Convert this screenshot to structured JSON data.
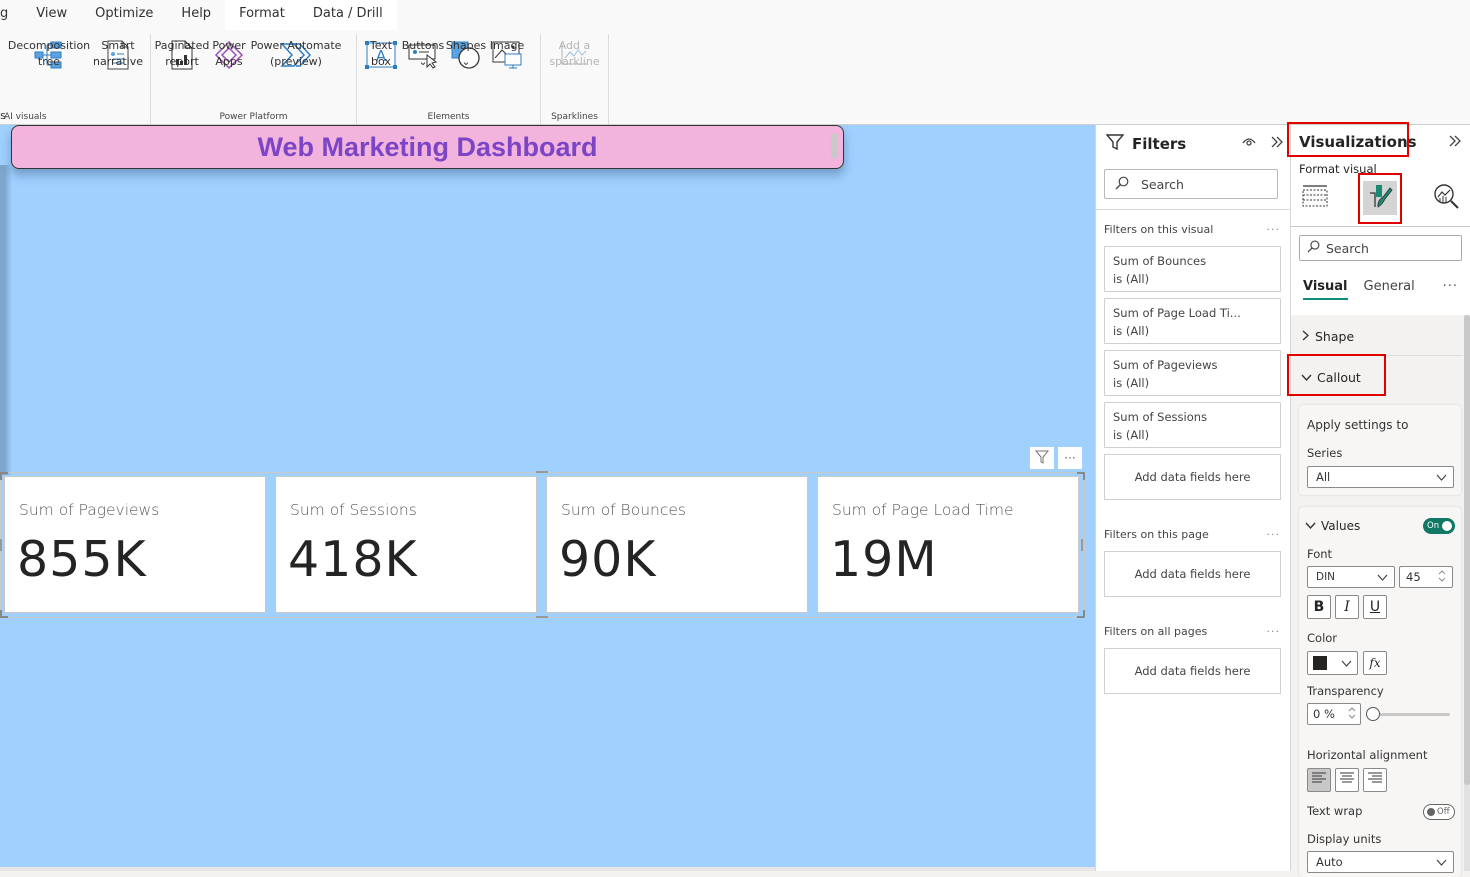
{
  "ribbon": {
    "tabs": [
      {
        "label": "g",
        "state": "normal"
      },
      {
        "label": "View",
        "state": "normal"
      },
      {
        "label": "Optimize",
        "state": "normal"
      },
      {
        "label": "Help",
        "state": "normal"
      },
      {
        "label": "Format",
        "state": "active"
      },
      {
        "label": "Data / Drill",
        "state": "contextual"
      }
    ],
    "groups": {
      "ai_visuals": {
        "label": "AI visuals",
        "partial_label": "s",
        "buttons": [
          {
            "label": "Decomposition\ntree",
            "icon": "decomposition-tree-icon"
          },
          {
            "label": "Smart\nnarrative",
            "icon": "smart-narrative-icon"
          }
        ]
      },
      "power_platform": {
        "label": "Power Platform",
        "buttons": [
          {
            "label": "Paginated\nreport",
            "icon": "paginated-report-icon"
          },
          {
            "label": "Power\nApps",
            "icon": "power-apps-icon"
          },
          {
            "label": "Power Automate\n(preview)",
            "icon": "power-automate-icon"
          }
        ]
      },
      "elements": {
        "label": "Elements",
        "buttons": [
          {
            "label": "Text\nbox",
            "icon": "text-box-icon"
          },
          {
            "label": "Buttons\n⌄",
            "icon": "buttons-icon"
          },
          {
            "label": "Shapes\n⌄",
            "icon": "shapes-icon"
          },
          {
            "label": "Image",
            "icon": "image-icon"
          }
        ]
      },
      "sparklines": {
        "label": "Sparklines",
        "buttons": [
          {
            "label": "Add a\nsparkline",
            "icon": "sparkline-icon",
            "disabled": true
          }
        ]
      }
    }
  },
  "canvas": {
    "background": "#a0d0fe",
    "title": {
      "text": "Web Marketing Dashboard",
      "bg": "#f2b3dc",
      "color": "#7b45c6"
    },
    "cards": [
      {
        "label": "Sum of Pageviews",
        "value": "855K"
      },
      {
        "label": "Sum of Sessions",
        "value": "418K"
      },
      {
        "label": "Sum of Bounces",
        "value": "90K"
      },
      {
        "label": "Sum of Page Load Time",
        "value": "19M"
      }
    ],
    "visual_header": {
      "filter_icon": "filter-icon",
      "more_label": "···"
    }
  },
  "filters": {
    "title": "Filters",
    "search_placeholder": "Search",
    "sections": {
      "visual": {
        "label": "Filters on this visual",
        "more": "···",
        "items": [
          {
            "field": "Sum of Bounces",
            "state": "is (All)"
          },
          {
            "field": "Sum of Page Load Ti...",
            "state": "is (All)"
          },
          {
            "field": "Sum of Pageviews",
            "state": "is (All)"
          },
          {
            "field": "Sum of Sessions",
            "state": "is (All)"
          }
        ],
        "add": "Add data fields here"
      },
      "page": {
        "label": "Filters on this page",
        "more": "···",
        "add": "Add data fields here"
      },
      "all": {
        "label": "Filters on all pages",
        "more": "···",
        "add": "Add data fields here"
      }
    }
  },
  "visualizations": {
    "title": "Visualizations",
    "subtitle": "Format visual",
    "search_placeholder": "Search",
    "tabs": [
      {
        "label": "Visual",
        "active": true
      },
      {
        "label": "General",
        "active": false
      }
    ],
    "more": "···",
    "sections": {
      "shape": {
        "label": "Shape",
        "expanded": false
      },
      "callout": {
        "label": "Callout",
        "expanded": true
      }
    },
    "apply_settings": {
      "label": "Apply settings to",
      "series_label": "Series",
      "series_value": "All"
    },
    "values": {
      "label": "Values",
      "toggle": "On",
      "font_label": "Font",
      "font_family": "DIN",
      "font_size": "45",
      "bold": "B",
      "italic": "I",
      "underline": "U",
      "color_label": "Color",
      "color_value": "#252423",
      "fx": "fx",
      "transparency_label": "Transparency",
      "transparency_value": "0 %",
      "transparency_percent": 0,
      "halign_label": "Horizontal alignment",
      "halign_selected": "left",
      "textwrap_label": "Text wrap",
      "textwrap_toggle": "Off",
      "display_units_label": "Display units",
      "display_units_value": "Auto"
    }
  }
}
